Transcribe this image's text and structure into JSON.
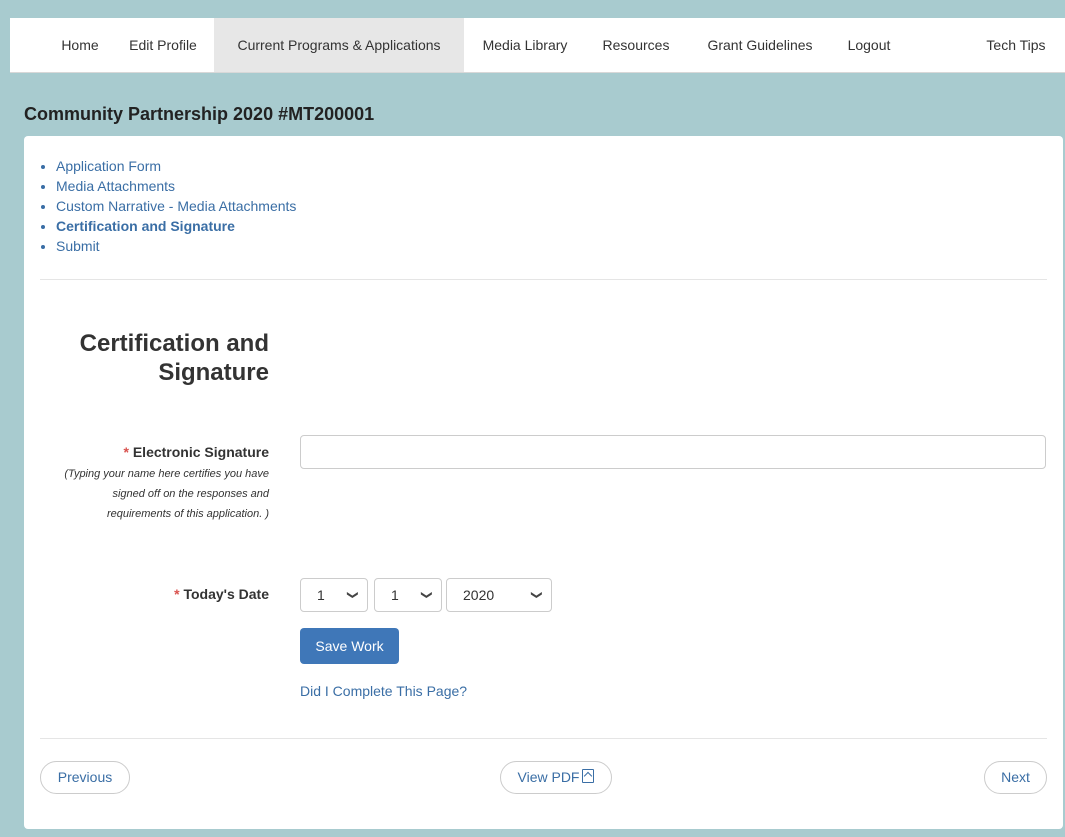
{
  "nav": {
    "home": "Home",
    "edit_profile": "Edit Profile",
    "current_programs": "Current Programs & Applications",
    "media_library": "Media Library",
    "resources": "Resources",
    "grant_guidelines": "Grant Guidelines",
    "logout": "Logout",
    "tech_tips": "Tech Tips"
  },
  "page_title": "Community Partnership 2020 #MT200001",
  "steps": [
    "Application Form",
    "Media Attachments",
    "Custom Narrative - Media Attachments",
    "Certification and Signature",
    "Submit"
  ],
  "section": {
    "title_line1": "Certification and",
    "title_line2": "Signature"
  },
  "signature": {
    "required_mark": "*",
    "label": "Electronic Signature",
    "hint_line1": "(Typing your name here certifies you have",
    "hint_line2": "signed off on the responses and",
    "hint_line3": "requirements of this application. )",
    "value": ""
  },
  "date": {
    "required_mark": "*",
    "label": "Today's Date",
    "month": "1",
    "day": "1",
    "year": "2020",
    "chevron_icon": "chevron-down-icon"
  },
  "save_label": "Save Work",
  "complete_link": "Did I Complete This Page?",
  "footer": {
    "previous": "Previous",
    "view_pdf": "View PDF",
    "pdf_icon": "pdf-icon",
    "next": "Next"
  },
  "colors": {
    "background": "#a8cbcf",
    "link": "#3a6ea5",
    "primary_button": "#3f77b8",
    "required": "#d9534f"
  }
}
